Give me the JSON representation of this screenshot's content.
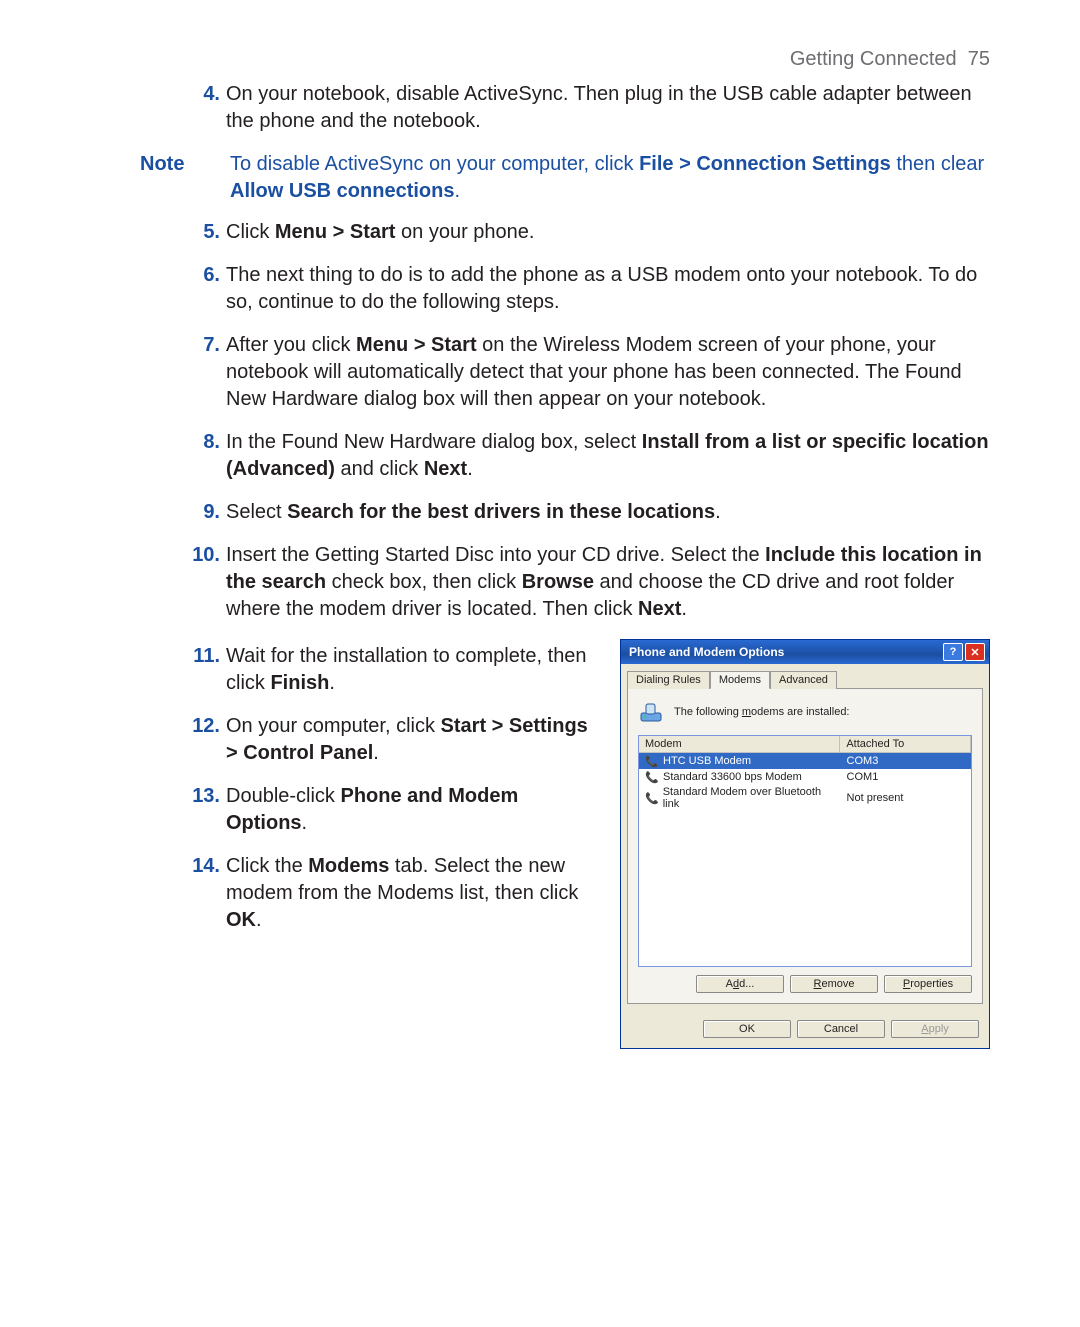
{
  "header": {
    "section": "Getting Connected",
    "page": "75"
  },
  "steps": {
    "s4": {
      "n": "4.",
      "t1": "On your notebook, disable ActiveSync. Then plug in the USB cable adapter between the phone and the notebook."
    },
    "note": {
      "label": "Note",
      "t1": "To disable ActiveSync on your computer, click ",
      "b1": "File > Connection Settings",
      "t2": " then clear ",
      "b2": "Allow USB connections",
      "t3": "."
    },
    "s5": {
      "n": "5.",
      "t1": "Click ",
      "b1": "Menu > Start",
      "t2": " on your phone."
    },
    "s6": {
      "n": "6.",
      "t1": "The next thing to do is to add the phone as a USB modem onto your notebook. To do so, continue to do the following steps."
    },
    "s7": {
      "n": "7.",
      "t1": "After you click ",
      "b1": "Menu > Start",
      "t2": " on the Wireless Modem screen of your phone, your notebook will automatically detect that your phone has been connected. The Found New Hardware dialog box will then appear on your notebook."
    },
    "s8": {
      "n": "8.",
      "t1": "In the Found New Hardware dialog box, select ",
      "b1": "Install from a list or specific location (Advanced)",
      "t2": " and click ",
      "b2": "Next",
      "t3": "."
    },
    "s9": {
      "n": "9.",
      "t1": "Select ",
      "b1": "Search for the best drivers in these locations",
      "t2": "."
    },
    "s10": {
      "n": "10.",
      "t1": "Insert the Getting Started Disc into your CD drive. Select the ",
      "b1": "Include this location in the search",
      "t2": " check box, then click ",
      "b2": "Browse",
      "t3": " and choose the CD drive and root folder where the modem driver is located. Then click ",
      "b3": "Next",
      "t4": "."
    },
    "s11": {
      "n": "11.",
      "t1": "Wait for the installation to complete, then click ",
      "b1": "Finish",
      "t2": "."
    },
    "s12": {
      "n": "12.",
      "t1": "On your computer, click ",
      "b1": "Start > Settings > Control Panel",
      "t2": "."
    },
    "s13": {
      "n": "13.",
      "t1": "Double-click ",
      "b1": "Phone and Modem Options",
      "t2": "."
    },
    "s14": {
      "n": "14.",
      "t1": "Click the ",
      "b1": "Modems",
      "t2": " tab. Select the new modem from the Modems list, then click ",
      "b2": "OK",
      "t3": "."
    }
  },
  "dialog": {
    "title": "Phone and Modem Options",
    "help": "?",
    "close": "✕",
    "tabs": {
      "t1": "Dialing Rules",
      "t2": "Modems",
      "t3": "Advanced"
    },
    "info": "The following modems are installed:",
    "cols": {
      "c1": "Modem",
      "c2": "Attached To"
    },
    "rows": [
      {
        "name": "HTC USB Modem",
        "port": "COM3"
      },
      {
        "name": "Standard 33600 bps Modem",
        "port": "COM1"
      },
      {
        "name": "Standard Modem over Bluetooth link",
        "port": "Not present"
      }
    ],
    "btns": {
      "add": "Add...",
      "remove": "Remove",
      "props": "Properties",
      "ok": "OK",
      "cancel": "Cancel",
      "apply": "Apply"
    }
  }
}
